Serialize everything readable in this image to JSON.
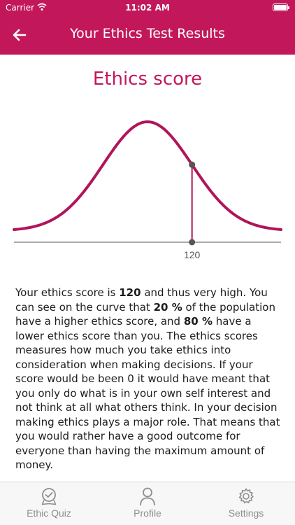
{
  "status": {
    "carrier": "Carrier",
    "time": "11:02 AM"
  },
  "nav": {
    "title": "Your Ethics Test Results"
  },
  "chart_title": "Ethics score",
  "chart_data": {
    "type": "line",
    "title": "Ethics score",
    "xlabel": "",
    "ylabel": "",
    "series": [
      {
        "values": "normal distribution curve"
      }
    ],
    "tick_labels": [
      "120"
    ],
    "marker_x": 120,
    "percent_higher": 20,
    "percent_lower": 80,
    "mean": 100,
    "sd": 20,
    "xlim": [
      40,
      160
    ],
    "grid": false,
    "line_color": "#b0155a"
  },
  "result": {
    "p1": "Your ethics score is ",
    "score": "120",
    "p2": " and thus very high. You can see on the curve that ",
    "higher": "20 %",
    "p3": " of the population have a higher ethics score, and ",
    "lower": "80 %",
    "p4": " have a lower ethics score than you. The ethics scores measures how much you take ethics into consideration when making decisions. If your score would be been 0 it would have meant that you only do what is in your own self interest and not think at all what others think. In your decision making ethics plays a major role. That means that you would rather have a good outcome for everyone than having the maximum amount of money."
  },
  "tabs": [
    {
      "label": "Ethic Quiz"
    },
    {
      "label": "Profile"
    },
    {
      "label": "Settings"
    }
  ]
}
